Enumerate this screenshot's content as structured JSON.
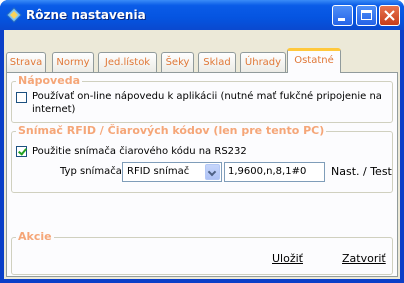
{
  "window": {
    "title": "Rôzne nastavenia"
  },
  "tabs": [
    {
      "label": "Strava"
    },
    {
      "label": "Normy"
    },
    {
      "label": "Jed.lístok"
    },
    {
      "label": "Šeky"
    },
    {
      "label": "Sklad"
    },
    {
      "label": "Úhrady"
    },
    {
      "label": "Ostatné"
    }
  ],
  "help_group": {
    "title": "Nápoveda",
    "checkbox_label_line1": "Používať on-line nápovedu k aplikácii (nutné mať fukčné pripojenie na",
    "checkbox_label_line2": "internet)",
    "checked": false
  },
  "rfid_group": {
    "title": "Snímač RFID / Čiarových kódov (len pre tento PC)",
    "checkbox_label": "Použitie snímača čiarového kódu na RS232",
    "checked": true,
    "type_label": "Typ snímača",
    "type_value": "RFID snímač",
    "port_value": "1,9600,n,8,1#0",
    "settings_label": "Nast. / Test"
  },
  "actions_group": {
    "title": "Akcie",
    "save_label": "Uložiť",
    "close_label": "Zatvoriť"
  },
  "colors": {
    "accent": "#f5a678",
    "tab_text": "#e07838",
    "titlebar": "#0554e0"
  }
}
